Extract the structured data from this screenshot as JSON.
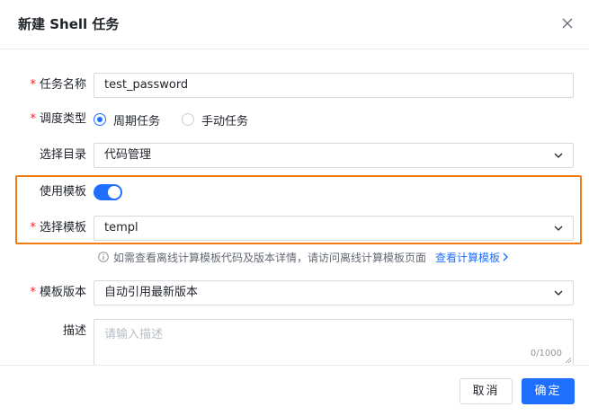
{
  "dialog": {
    "title": "新建 Shell 任务"
  },
  "form": {
    "task_name": {
      "label": "任务名称",
      "required": true,
      "value": "test_password"
    },
    "schedule_type": {
      "label": "调度类型",
      "required": true,
      "options": [
        "周期任务",
        "手动任务"
      ],
      "selected": "周期任务"
    },
    "directory": {
      "label": "选择目录",
      "required": false,
      "value": "代码管理"
    },
    "use_template": {
      "label": "使用模板",
      "required": false,
      "enabled": true
    },
    "template": {
      "label": "选择模板",
      "required": true,
      "value": "templ"
    },
    "hint": {
      "text": "如需查看离线计算模板代码及版本详情，请访问离线计算模板页面",
      "link": "查看计算模板"
    },
    "template_version": {
      "label": "模板版本",
      "required": true,
      "value": "自动引用最新版本"
    },
    "description": {
      "label": "描述",
      "required": false,
      "placeholder": "请输入描述",
      "counter": "0/1000"
    }
  },
  "footer": {
    "cancel_label": "取消",
    "ok_label": "确定"
  },
  "colors": {
    "primary": "#1f6fff",
    "highlight": "#f07b12",
    "required": "#f5222d"
  }
}
